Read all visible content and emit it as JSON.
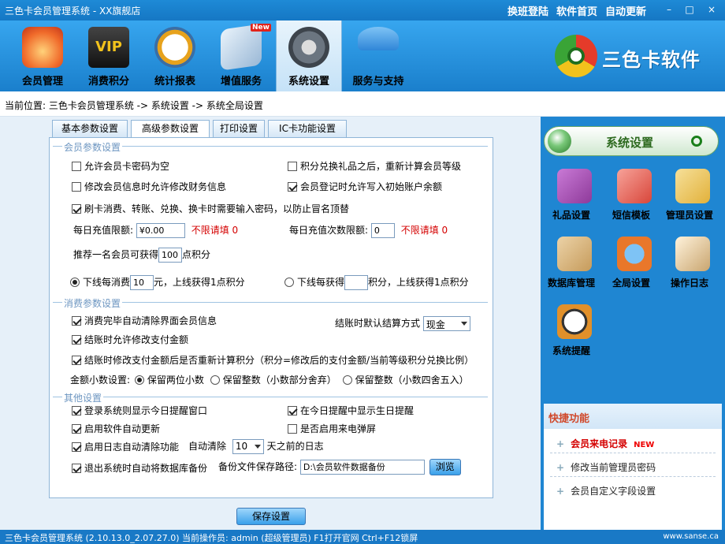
{
  "window": {
    "title": "三色卡会员管理系统 - XX旗舰店",
    "links": [
      "换班登陆",
      "软件首页",
      "自动更新"
    ]
  },
  "toolbar": {
    "items": [
      {
        "label": "会员管理",
        "icon": "members-balloon-icon",
        "color": "#f06a2a"
      },
      {
        "label": "消费积分",
        "icon": "vip-card-icon",
        "color": "#2a2a2a"
      },
      {
        "label": "统计报表",
        "icon": "clock-globe-icon",
        "color": "#e7a21c"
      },
      {
        "label": "增值服务",
        "icon": "value-added-card-icon",
        "color": "#9ab8d6",
        "badge": "New"
      },
      {
        "label": "系统设置",
        "icon": "gear-settings-icon",
        "color": "#6b7580"
      },
      {
        "label": "服务与支持",
        "icon": "umbrella-support-icon",
        "color": "#2f86d8"
      }
    ],
    "active": 4
  },
  "brand": {
    "name": "三色卡软件"
  },
  "breadcrumb": "当前位置: 三色卡会员管理系统 -> 系统设置 -> 系统全局设置",
  "tabs": [
    "基本参数设置",
    "高级参数设置",
    "打印设置",
    "IC卡功能设置"
  ],
  "selected_tab": 1,
  "member": {
    "legend": "会员参数设置",
    "cb_allow_empty_pwd": "允许会员卡密码为空",
    "cb_recalc_level": "积分兑换礼品之后，重新计算会员等级",
    "cb_allow_edit_finance": "修改会员信息时允许修改财务信息",
    "cb_allow_init_balance": "会员登记时允许写入初始账户余额",
    "cb_require_pwd": "刷卡消费、转账、兑换、换卡时需要输入密码，以防止冒名顶替",
    "daily_limit_label": "每日充值限额:",
    "daily_limit_value": "¥0.00",
    "unlimited_note1": "不限请填 0",
    "daily_count_label": "每日充值次数限额:",
    "daily_count_value": "0",
    "unlimited_note2": "不限请填 0",
    "recommend_prefix": "推荐一名会员可获得",
    "recommend_value": "100",
    "recommend_suffix": "点积分",
    "radio1_prefix": "下线每消费",
    "radio1_value": "10",
    "radio1_suffix": "元，上线获得1点积分",
    "radio2_prefix": "下线每获得",
    "radio2_value": "",
    "radio2_suffix": "积分，上线获得1点积分"
  },
  "consume": {
    "legend": "消费参数设置",
    "cb_clear_after": "消费完毕自动清除界面会员信息",
    "settle_label": "结账时默认结算方式",
    "settle_value": "现金",
    "cb_allow_edit_amount": "结账时允许修改支付金额",
    "cb_recalc_points": "结账时修改支付金额后是否重新计算积分（积分=修改后的支付金额/当前等级积分兑换比例）",
    "decimal_label": "金额小数设置:",
    "decimal_opt1": "保留两位小数",
    "decimal_opt2": "保留整数（小数部分舍弃）",
    "decimal_opt3": "保留整数（小数四舍五入）"
  },
  "other": {
    "legend": "其他设置",
    "cb_reminder": "登录系统则显示今日提醒窗口",
    "cb_birthday": "在今日提醒中显示生日提醒",
    "cb_autoupdate": "启用软件自动更新",
    "cb_callpopup": "是否启用来电弹屏",
    "cb_log_clear": "启用日志自动清除功能",
    "auto_clear_label": "自动清除",
    "auto_clear_value": "10",
    "auto_clear_suffix": "天之前的日志",
    "cb_backup": "退出系统时自动将数据库备份",
    "backup_path_label": "备份文件保存路径:",
    "backup_path_value": "D:\\会员软件数据备份",
    "browse": "浏览"
  },
  "save": "保存设置",
  "side": {
    "title": "系统设置",
    "icons": [
      {
        "label": "礼品设置",
        "icon": "gift-settings-icon",
        "color": "#8e3a9a"
      },
      {
        "label": "短信模板",
        "icon": "sms-template-icon",
        "color": "#d8463a"
      },
      {
        "label": "管理员设置",
        "icon": "admin-keys-icon",
        "color": "#e2b13a"
      },
      {
        "label": "数据库管理",
        "icon": "database-icon",
        "color": "#c69b5b"
      },
      {
        "label": "全局设置",
        "icon": "global-settings-icon",
        "color": "#e9772a"
      },
      {
        "label": "操作日志",
        "icon": "operation-log-icon",
        "color": "#c9a56f"
      },
      {
        "label": "系统提醒",
        "icon": "system-reminder-icon",
        "color": "#e1902a"
      }
    ],
    "quick": {
      "title": "快捷功能",
      "items": [
        "会员来电记录",
        "修改当前管理员密码",
        "会员自定义字段设置"
      ],
      "new_badge": "NEW"
    }
  },
  "status": {
    "left": "三色卡会员管理系统 (2.10.13.0_2.07.27.0)  当前操作员: admin (超级管理员)  F1打开官网 Ctrl+F12锁屏",
    "right": "www.sanse.ca"
  }
}
